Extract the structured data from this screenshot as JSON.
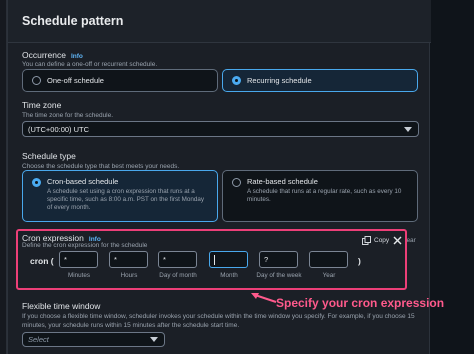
{
  "panel": {
    "title": "Schedule pattern"
  },
  "occurrence": {
    "label": "Occurrence",
    "info": "Info",
    "description": "You can define a one-off or recurrent schedule.",
    "options": [
      {
        "label": "One-off schedule",
        "selected": false
      },
      {
        "label": "Recurring schedule",
        "selected": true
      }
    ]
  },
  "timezone": {
    "label": "Time zone",
    "description": "The time zone for the schedule.",
    "value": "(UTC+00:00) UTC"
  },
  "schedule_type": {
    "label": "Schedule type",
    "description": "Choose the schedule type that best meets your needs.",
    "options": [
      {
        "title": "Cron-based schedule",
        "desc_lines": [
          "A schedule set using a cron expression that runs at a",
          "specific time, such as 8:00 a.m. PST on the first Monday",
          "of every month."
        ],
        "selected": true
      },
      {
        "title": "Rate-based schedule",
        "desc_lines": [
          "A schedule that runs at a regular rate, such as every 10",
          "minutes."
        ],
        "selected": false
      }
    ]
  },
  "cron": {
    "label": "Cron expression",
    "info": "Info",
    "description": "Define the cron expression for the schedule",
    "copy_label": "Copy",
    "clear_label": "lear",
    "prefix": "cron (",
    "suffix": ")",
    "fields": [
      {
        "value": "*",
        "label": "Minutes",
        "focused": false
      },
      {
        "value": "*",
        "label": "Hours",
        "focused": false
      },
      {
        "value": "*",
        "label": "Day of month",
        "focused": false
      },
      {
        "value": "",
        "label": "Month",
        "focused": true
      },
      {
        "value": "?",
        "label": "Day of the week",
        "focused": false
      },
      {
        "value": "",
        "label": "Year",
        "focused": false
      }
    ]
  },
  "annotation": {
    "text": "Specify your cron expression",
    "color": "#ff5a8c"
  },
  "flexible_window": {
    "label": "Flexible time window",
    "description_lines": [
      "If you choose a flexible time window, scheduler invokes your schedule within the time window you specify. For example, if you choose 15",
      "minutes, your schedule runs within 15 minutes after the schedule start time."
    ],
    "placeholder": "Select"
  },
  "colors": {
    "accent": "#49a8ec",
    "highlight": "#ec3f78",
    "info": "#5fb4f5"
  }
}
